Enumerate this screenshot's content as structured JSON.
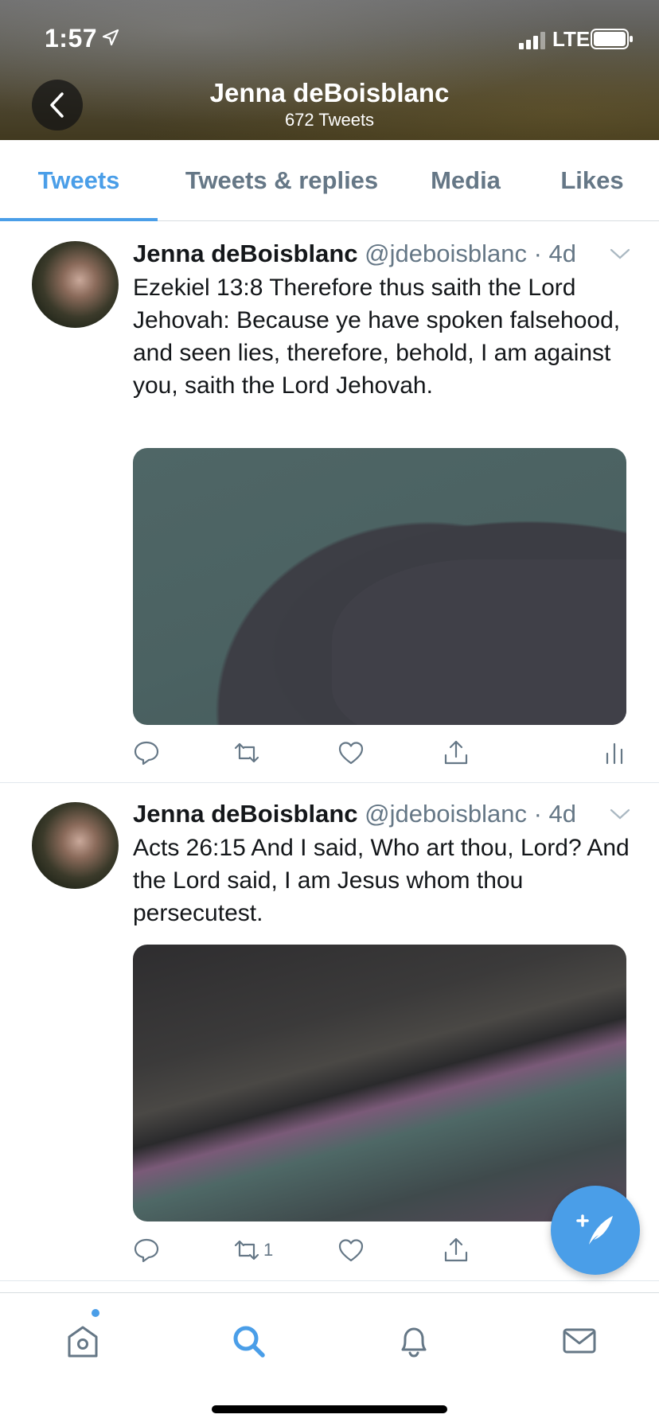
{
  "status_bar": {
    "time": "1:57",
    "network": "LTE"
  },
  "header": {
    "title": "Jenna deBoisblanc",
    "subtitle": "672 Tweets"
  },
  "tabs": [
    {
      "label": "Tweets",
      "active": true
    },
    {
      "label": "Tweets & replies",
      "active": false
    },
    {
      "label": "Media",
      "active": false
    },
    {
      "label": "Likes",
      "active": false
    }
  ],
  "tweets": [
    {
      "name": "Jenna deBoisblanc",
      "handle": "@jdeboisblanc",
      "time": "· 4d",
      "text": "Ezekiel 13:8 Therefore thus saith the Lord Jehovah: Because ye have spoken falsehood, and seen lies, therefore, behold, I am against you, saith the Lord Jehovah.",
      "retweet_count": ""
    },
    {
      "name": "Jenna deBoisblanc",
      "handle": "@jdeboisblanc",
      "time": "· 4d",
      "text": "Acts 26:15 And I said, Who art thou, Lord? And the Lord said, I am Jesus whom thou persecutest.",
      "retweet_count": "1"
    }
  ],
  "colors": {
    "accent": "#4a9ee8",
    "secondary_text": "#657786"
  },
  "icons": {
    "back": "chevron-left-icon",
    "compose": "compose-tweet-icon",
    "nav": [
      "home-icon",
      "search-icon",
      "notifications-icon",
      "messages-icon"
    ],
    "actions": [
      "reply-icon",
      "retweet-icon",
      "like-icon",
      "share-icon",
      "analytics-icon"
    ]
  }
}
